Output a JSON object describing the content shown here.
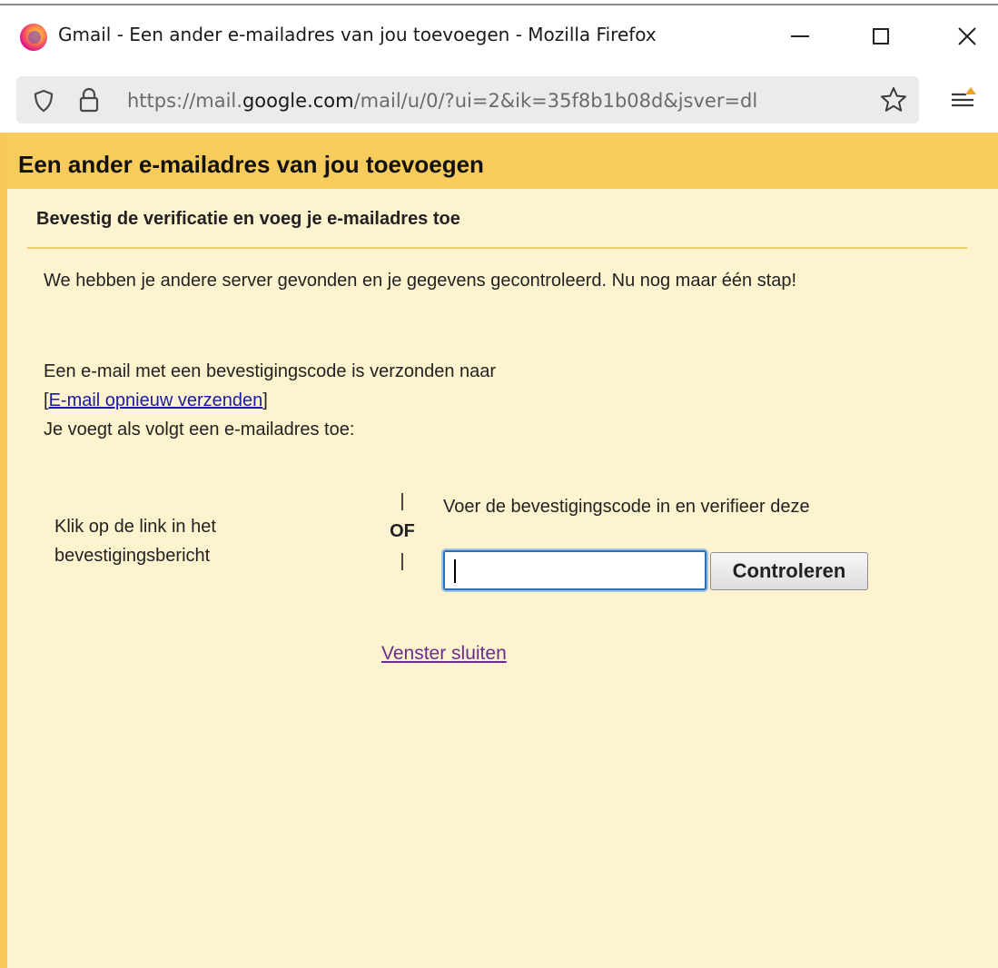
{
  "browser": {
    "window_title": "Gmail - Een ander e-mailadres van jou toevoegen - Mozilla Firefox",
    "url_prefix": "https://mail.",
    "url_domain": "google.com",
    "url_rest": "/mail/u/0/?ui=2&ik=35f8b1b08d&jsver=dl",
    "icons": {
      "logo": "firefox-logo-icon",
      "minimize": "minimize-icon",
      "maximize": "maximize-icon",
      "close": "close-icon",
      "shield": "tracking-protection-shield-icon",
      "lock": "lock-icon",
      "star": "bookmark-star-icon",
      "menu": "app-menu-icon"
    }
  },
  "dialog": {
    "title": "Een ander e-mailadres van jou toevoegen",
    "section_title": "Bevestig de verificatie en voeg je e-mailadres toe",
    "intro": "We hebben je andere server gevonden en je gegevens gecontroleerd. Nu nog maar één stap!",
    "sent_text": "Een e-mail met een bevestigingscode is verzonden naar",
    "resend_open": "[",
    "resend_link": "E-mail opnieuw verzenden",
    "resend_close": "]",
    "howto_text": "Je voegt als volgt een e-mailadres toe:",
    "option_link_text": "Klik op de link in het bevestigingsbericht",
    "or_bar_top": "|",
    "or_text": "OF",
    "or_bar_bottom": "|",
    "option_code_text": "Voer de bevestigingscode in en verifieer deze",
    "code_input_value": "",
    "verify_button": "Controleren",
    "close_link": "Venster sluiten"
  },
  "colors": {
    "header_bg": "#f8cc5c",
    "page_bg": "#fef3cf",
    "link": "#1a1aa6",
    "visited_link": "#6a2d8e",
    "focus_ring": "#2f6fb0"
  }
}
